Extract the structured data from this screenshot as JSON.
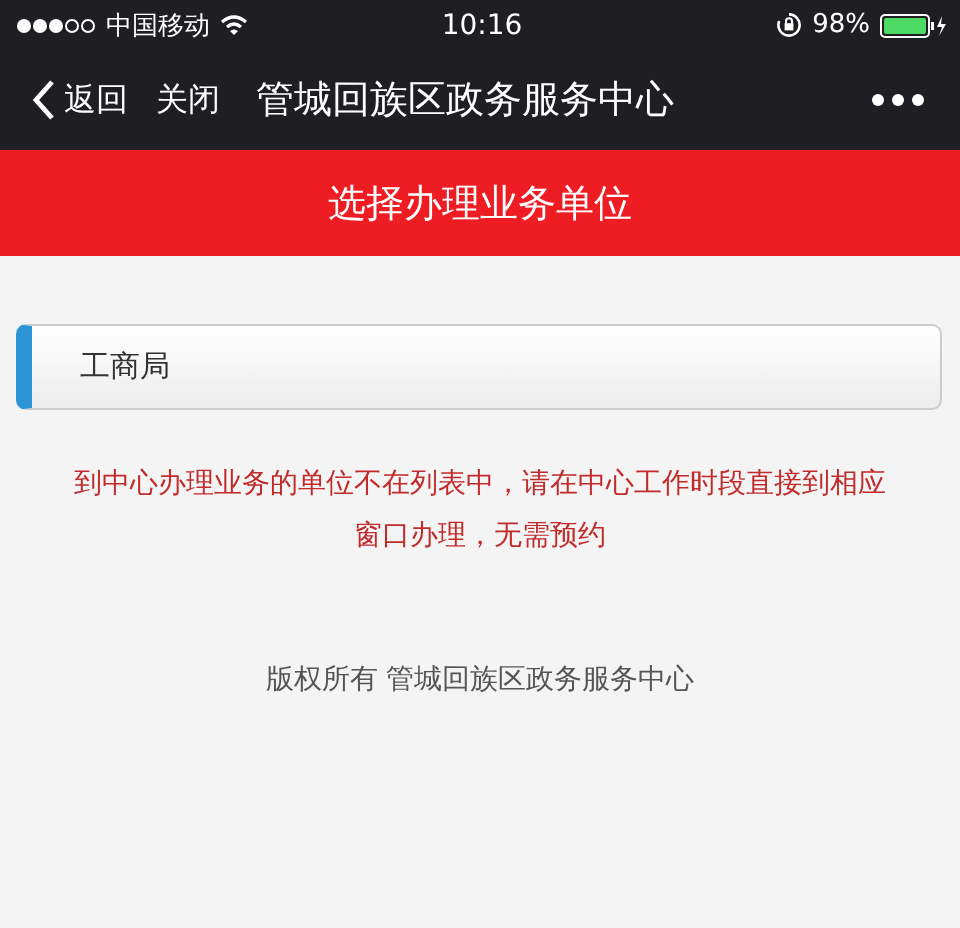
{
  "status_bar": {
    "carrier": "中国移动",
    "time": "10:16",
    "battery": "98%"
  },
  "nav_bar": {
    "back": "返回",
    "close": "关闭",
    "title": "管城回族区政务服务中心"
  },
  "banner": {
    "title": "选择办理业务单位"
  },
  "units": [
    {
      "label": "工商局"
    }
  ],
  "notice": "到中心办理业务的单位不在列表中，请在中心工作时段直接到相应窗口办理，无需预约",
  "footer": "版权所有 管城回族区政务服务中心"
}
